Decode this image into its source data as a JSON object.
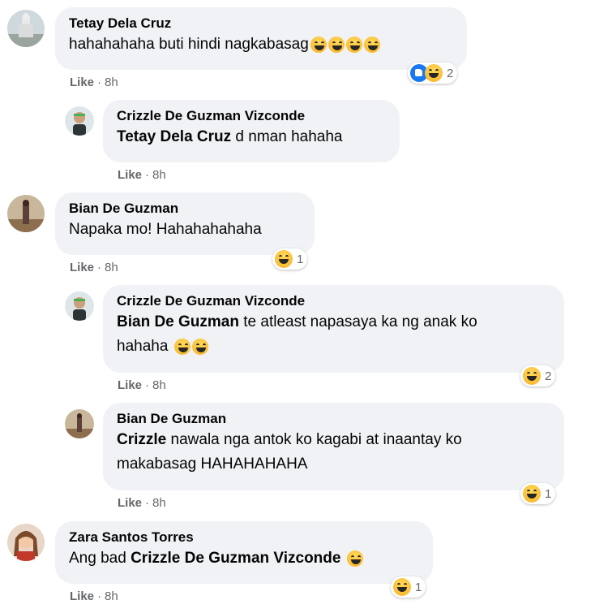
{
  "comments": [
    {
      "name": "Tetay Dela Cruz",
      "text": "hahahahaha buti hindi nagkabasag",
      "like": "Like",
      "time": "8h",
      "reaction_count": "2"
    },
    {
      "name": "Crizzle De Guzman Vizconde",
      "mention": "Tetay Dela Cruz",
      "text": " d nman hahaha",
      "like": "Like",
      "time": "8h"
    },
    {
      "name": "Bian De Guzman",
      "text": "Napaka mo! Hahahahahaha",
      "like": "Like",
      "time": "8h",
      "reaction_count": "1"
    },
    {
      "name": "Crizzle De Guzman Vizconde",
      "mention": "Bian De Guzman",
      "text": " te atleast napasaya ka ng anak ko",
      "text2": "hahaha",
      "like": "Like",
      "time": "8h",
      "reaction_count": "2"
    },
    {
      "name": "Bian De Guzman",
      "mention": "Crizzle",
      "text": " nawala nga antok ko kagabi at inaantay ko",
      "text2": "makabasag HAHAHAHAHA",
      "like": "Like",
      "time": "8h",
      "reaction_count": "1"
    },
    {
      "name": "Zara Santos Torres",
      "text": "Ang bad ",
      "mention": "Crizzle De Guzman Vizconde",
      "like": "Like",
      "time": "8h",
      "reaction_count": "1"
    }
  ],
  "meta_separator": "·",
  "colors": {
    "bubble": "#f0f2f5",
    "meta": "#65676b",
    "text": "#050505",
    "like_blue": "#1877f2",
    "haha_yellow": "#f7b125"
  },
  "icons": {
    "haha": "haha-emoji-icon",
    "like": "like-reaction-icon"
  }
}
